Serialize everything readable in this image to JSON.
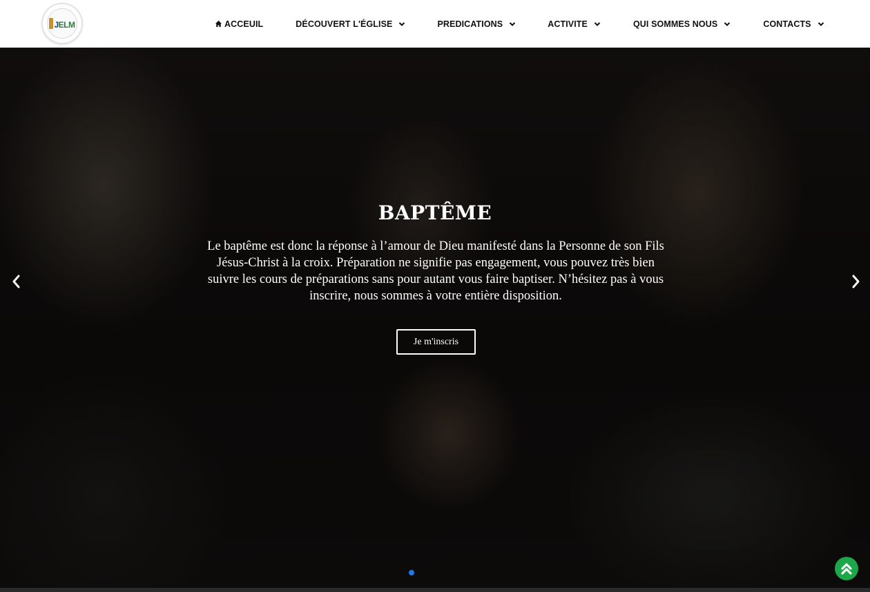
{
  "logo": {
    "text_l": "J",
    "text_main": "ELM"
  },
  "nav": {
    "items": [
      {
        "label": "ACCEUIL"
      },
      {
        "label": "DÉCOUVERT L'ÉGLISE"
      },
      {
        "label": "PREDICATIONS"
      },
      {
        "label": "ACTIVITE"
      },
      {
        "label": "QUI SOMMES NOUS"
      },
      {
        "label": "CONTACTS"
      }
    ]
  },
  "hero": {
    "title": "BAPTÊME",
    "text": "Le baptême est donc la réponse à l’amour de Dieu manifesté dans la Personne de son Fils Jésus-Christ à la croix. Préparation ne signifie pas engagement, vous pouvez très bien suivre les cours de préparations sans pour autant vous faire baptiser. N’hésitez pas à vous inscrire, nous sommes à votre entière disposition.",
    "button_label": "Je m'inscris"
  },
  "colors": {
    "accent_dot": "#1e7be6",
    "scroll_top": "#1ca84a"
  },
  "icons": [
    "home-icon",
    "chevron-down-icon",
    "chevron-left-icon",
    "chevron-right-icon",
    "double-chevron-up-icon"
  ]
}
